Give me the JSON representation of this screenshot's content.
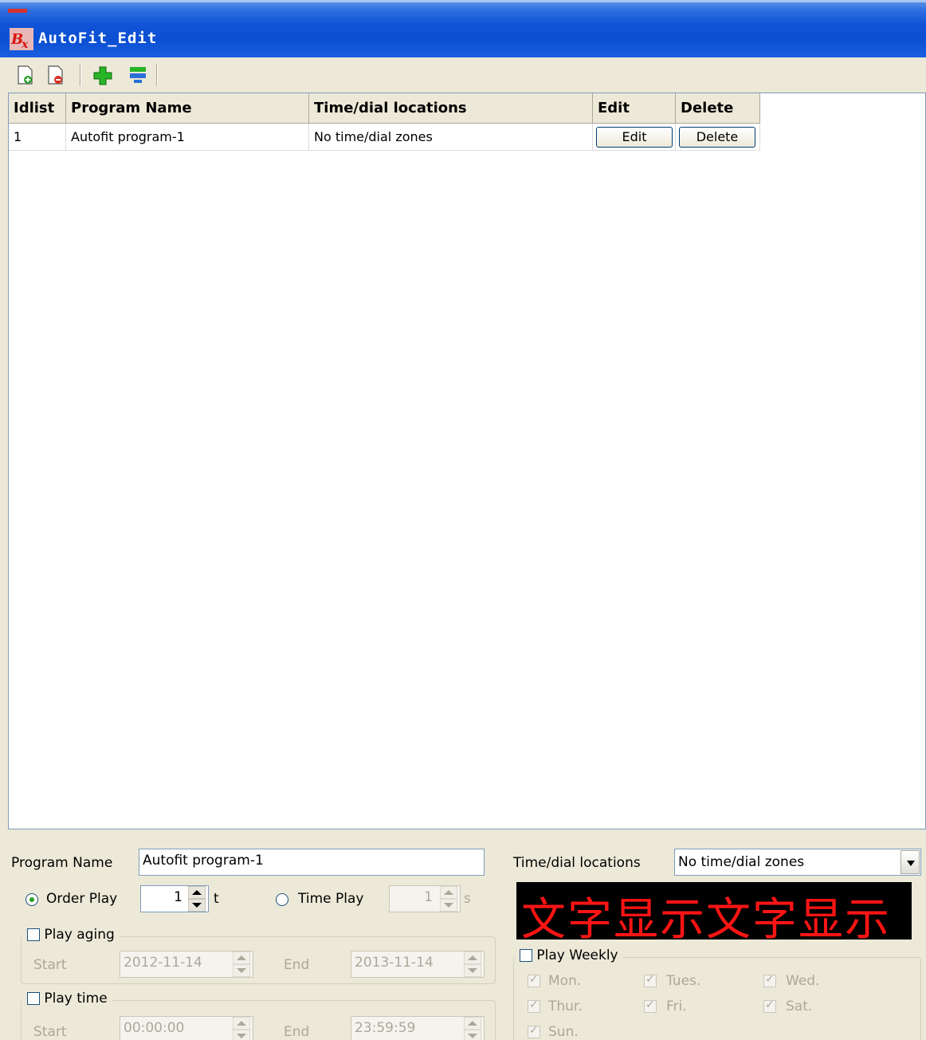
{
  "window": {
    "title": "AutoFit_Edit",
    "icon_text": "Bx"
  },
  "toolbar": {
    "items": [
      "new-file-icon",
      "delete-file-icon",
      "add-icon",
      "edit-icon"
    ]
  },
  "grid": {
    "columns": [
      "Idlist",
      "Program Name",
      "Time/dial locations",
      "Edit",
      "Delete"
    ],
    "rows": [
      {
        "id": "1",
        "name": "Autofit program-1",
        "time": "No time/dial zones",
        "edit": "Edit",
        "delete": "Delete"
      }
    ]
  },
  "form": {
    "program_name_label": "Program Name",
    "program_name_value": "Autofit program-1",
    "time_dial_label": "Time/dial locations",
    "time_dial_value": "No time/dial zones",
    "order_play_label": "Order Play",
    "order_play_value": "1",
    "order_play_unit": "t",
    "time_play_label": "Time Play",
    "time_play_value": "1",
    "time_play_unit": "s",
    "play_aging_label": "Play aging",
    "aging_start_label": "Start",
    "aging_start_value": "2012-11-14",
    "aging_end_label": "End",
    "aging_end_value": "2013-11-14",
    "play_time_label": "Play time",
    "time_start_label": "Start",
    "time_start_value": "00:00:00",
    "time_end_label": "End",
    "time_end_value": "23:59:59",
    "play_weekly_label": "Play Weekly",
    "days": [
      "Mon.",
      "Tues.",
      "Wed.",
      "Thur.",
      "Fri.",
      "Sat.",
      "Sun."
    ],
    "preview_text": "文字显示文字显示"
  },
  "colors": {
    "titlebar": "#0b4fd4",
    "led_text": "#ff1414",
    "led_bg": "#000000"
  }
}
